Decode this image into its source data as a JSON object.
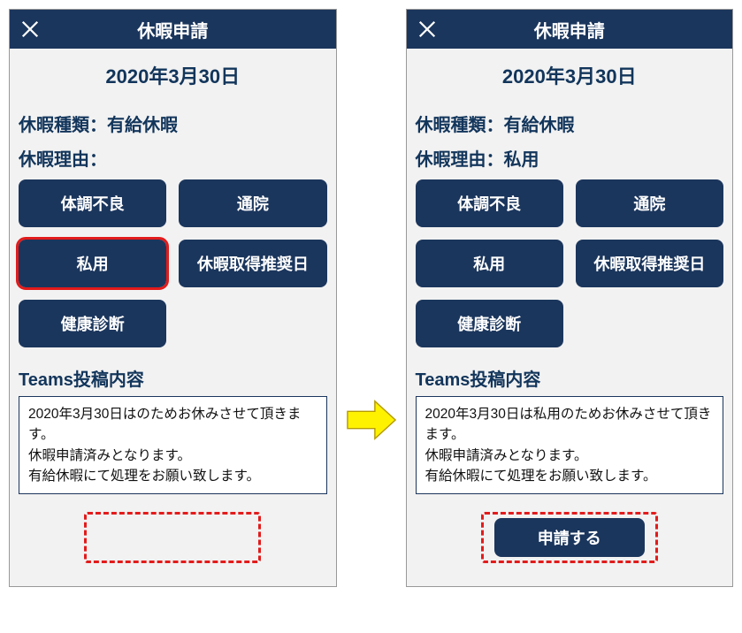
{
  "left": {
    "header": {
      "title": "休暇申請"
    },
    "date": "2020年3月30日",
    "leaveTypeLabel": "休暇種類：",
    "leaveTypeValue": "有給休暇",
    "leaveReasonLabel": "休暇理由：",
    "leaveReasonValue": "",
    "reasons": [
      "体調不良",
      "通院",
      "私用",
      "休暇取得推奨日",
      "健康診断"
    ],
    "highlightedReasonIndex": 2,
    "teamsLabel": "Teams投稿内容",
    "teamsBody": "2020年3月30日はのためお休みさせて頂きます。\n休暇申請済みとなります。\n有給休暇にて処理をお願い致します。",
    "submitLabel": ""
  },
  "right": {
    "header": {
      "title": "休暇申請"
    },
    "date": "2020年3月30日",
    "leaveTypeLabel": "休暇種類：",
    "leaveTypeValue": "有給休暇",
    "leaveReasonLabel": "休暇理由：",
    "leaveReasonValue": "私用",
    "reasons": [
      "体調不良",
      "通院",
      "私用",
      "休暇取得推奨日",
      "健康診断"
    ],
    "highlightedReasonIndex": -1,
    "teamsLabel": "Teams投稿内容",
    "teamsBody": "2020年3月30日は私用のためお休みさせて頂きます。\n休暇申請済みとなります。\n有給休暇にて処理をお願い致します。",
    "submitLabel": "申請する"
  },
  "colors": {
    "navy": "#1b365d",
    "red": "#e21b1b",
    "yellow": "#fff200"
  }
}
